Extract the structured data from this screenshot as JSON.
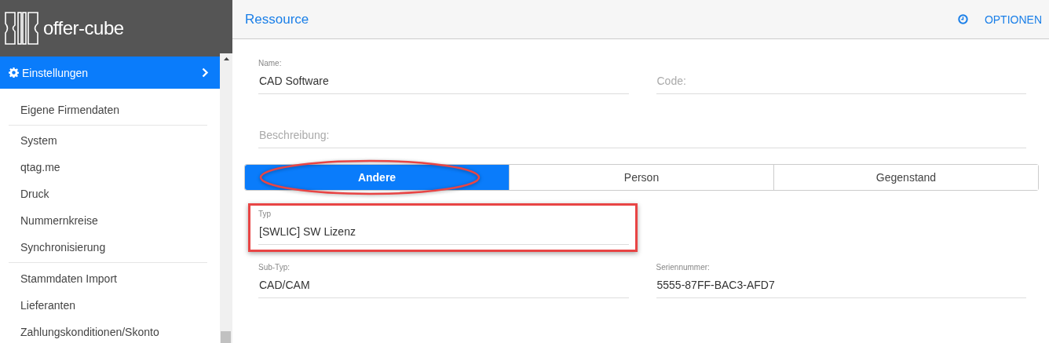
{
  "brand": {
    "name": "offer-cube"
  },
  "sidebar": {
    "section": {
      "label": "Einstellungen",
      "expanded": true
    },
    "groups": [
      [
        {
          "label": "Eigene Firmendaten"
        }
      ],
      [
        {
          "label": "System"
        },
        {
          "label": "qtag.me"
        },
        {
          "label": "Druck"
        },
        {
          "label": "Nummernkreise"
        },
        {
          "label": "Synchronisierung"
        }
      ],
      [
        {
          "label": "Stammdaten Import"
        },
        {
          "label": "Lieferanten"
        },
        {
          "label": "Zahlungskonditionen/Skonto"
        }
      ]
    ]
  },
  "header": {
    "title": "Ressource",
    "options": "OPTIONEN"
  },
  "form_top": [
    {
      "kind": "text",
      "label": "Name:",
      "value": "CAD Software"
    },
    {
      "kind": "text",
      "placeholder": "Code:"
    },
    {
      "kind": "textarea",
      "placeholder": "Beschreibung:"
    }
  ],
  "type_tabs": [
    {
      "label": "Andere",
      "selected": true,
      "highlighted": true
    },
    {
      "label": "Person",
      "selected": false,
      "highlighted": false
    },
    {
      "label": "Gegenstand",
      "selected": false,
      "highlighted": false
    }
  ],
  "form_bottom": [
    {
      "kind": "select",
      "label": "Typ",
      "value": "[SWLIC] SW Lizenz",
      "highlighted": true
    },
    {
      "kind": "text",
      "label": "Sub-Typ:",
      "value": "CAD/CAM"
    },
    {
      "kind": "text",
      "label": "Seriennummer:",
      "value": "5555-87FF-BAC3-AFD7"
    }
  ]
}
